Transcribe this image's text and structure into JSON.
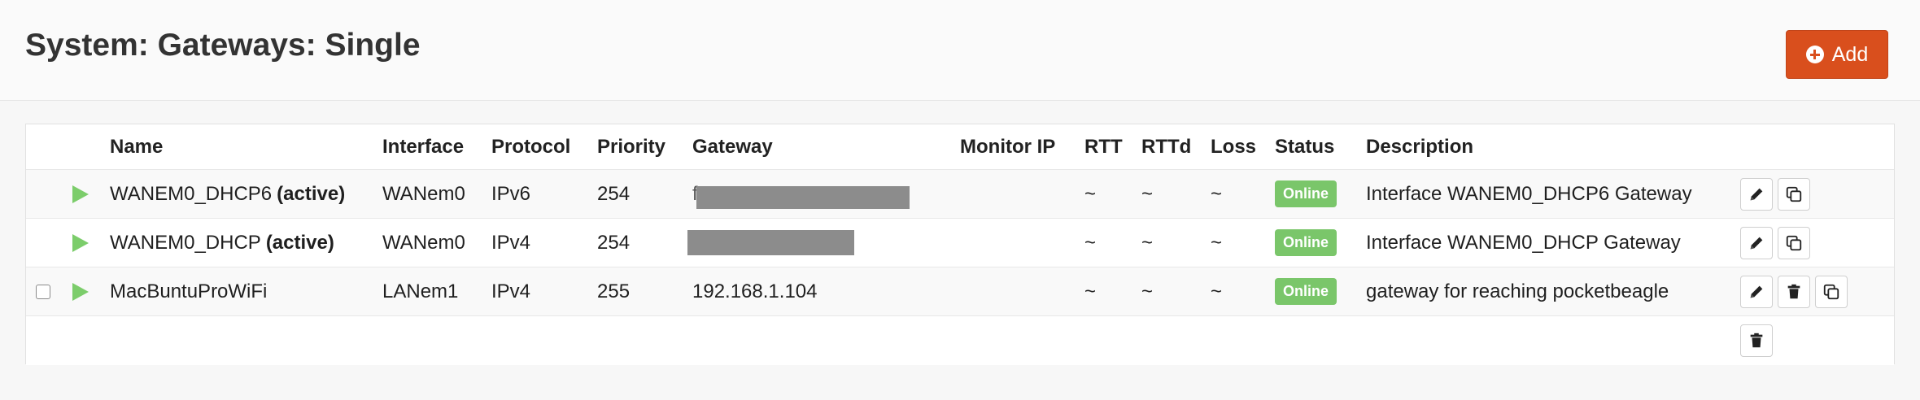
{
  "page": {
    "title": "System: Gateways: Single",
    "add_label": "Add"
  },
  "table": {
    "headers": {
      "name": "Name",
      "interface": "Interface",
      "protocol": "Protocol",
      "priority": "Priority",
      "gateway": "Gateway",
      "monitor_ip": "Monitor IP",
      "rtt": "RTT",
      "rttd": "RTTd",
      "loss": "Loss",
      "status": "Status",
      "description": "Description"
    },
    "rows": [
      {
        "name": "WANEM0_DHCP6",
        "active": "(active)",
        "interface": "WANem0",
        "protocol": "IPv6",
        "priority": "254",
        "gateway": "f",
        "monitor_ip": "",
        "rtt": "~",
        "rttd": "~",
        "loss": "~",
        "status": "Online",
        "description": "Interface WANEM0_DHCP6 Gateway"
      },
      {
        "name": "WANEM0_DHCP",
        "active": "(active)",
        "interface": "WANem0",
        "protocol": "IPv4",
        "priority": "254",
        "gateway": "",
        "monitor_ip": "",
        "rtt": "~",
        "rttd": "~",
        "loss": "~",
        "status": "Online",
        "description": "Interface WANEM0_DHCP Gateway"
      },
      {
        "name": "MacBuntuProWiFi",
        "active": "",
        "interface": "LANem1",
        "protocol": "IPv4",
        "priority": "255",
        "gateway": "192.168.1.104",
        "monitor_ip": "",
        "rtt": "~",
        "rttd": "~",
        "loss": "~",
        "status": "Online",
        "description": "gateway for reaching pocketbeagle"
      }
    ]
  },
  "colors": {
    "accent": "#d94f1d",
    "online": "#7ac66a",
    "play": "#7ccd6b"
  }
}
